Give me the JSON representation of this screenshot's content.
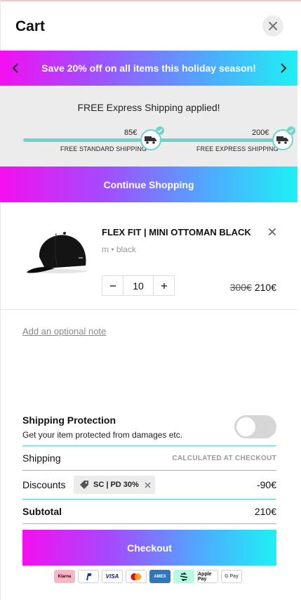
{
  "header": {
    "title": "Cart"
  },
  "promo": {
    "message": "Save 20% off on all items this holiday season!"
  },
  "shipping": {
    "applied_text": "FREE Express Shipping applied!",
    "milestones": [
      {
        "amount": "85€",
        "label": "FREE STANDARD SHIPPING"
      },
      {
        "amount": "200€",
        "label": "FREE EXPRESS SHIPPING"
      }
    ]
  },
  "continue_label": "Continue Shopping",
  "item": {
    "name": "FLEX FIT | MINI OTTOMAN BLACK",
    "variant": "m • black",
    "quantity": "10",
    "old_price": "300€",
    "new_price": "210€"
  },
  "note_label": "Add an optional note",
  "protection": {
    "title": "Shipping Protection",
    "description": "Get your item protected from damages etc."
  },
  "summary": {
    "shipping_label": "Shipping",
    "shipping_value": "CALCULATED AT CHECKOUT",
    "discounts_label": "Discounts",
    "discount_code": "SC | PD 30%",
    "discount_value": "-90€",
    "subtotal_label": "Subtotal",
    "subtotal_value": "210€"
  },
  "checkout_label": "Checkout",
  "payment_methods": [
    "Klarna",
    "PayPal",
    "VISA",
    "Mastercard",
    "AMEX",
    "Afterpay",
    "Apple Pay",
    "G Pay"
  ],
  "colors": {
    "accent_teal": "#53d6cc",
    "gradient_start": "#f40ff0",
    "gradient_end": "#1ef0f4"
  }
}
